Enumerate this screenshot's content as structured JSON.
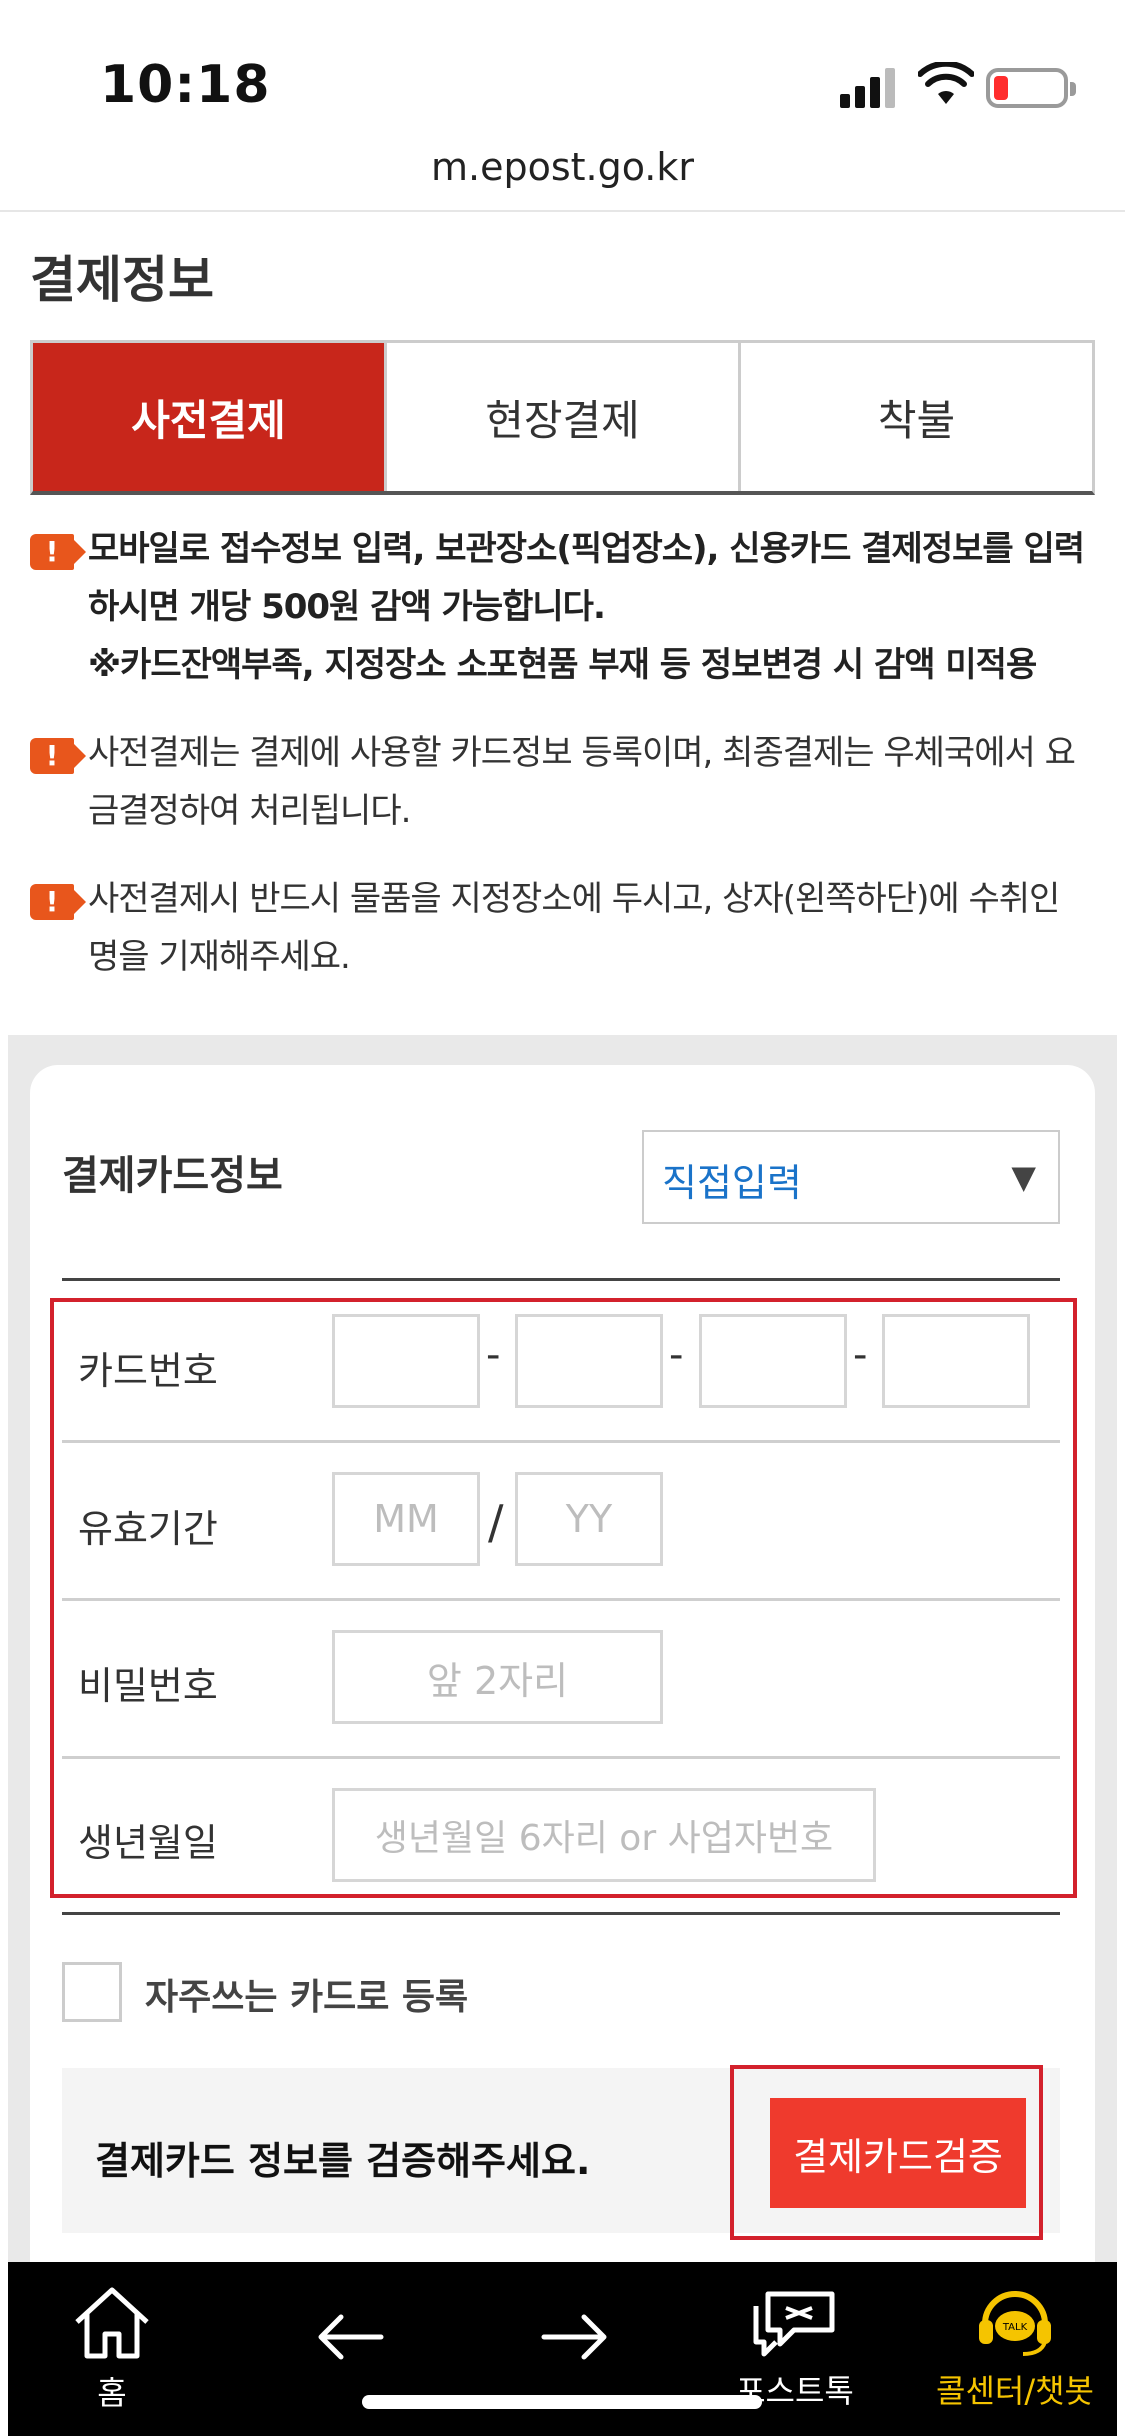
{
  "status_bar": {
    "time": "10:18",
    "url": "m.epost.go.kr"
  },
  "page": {
    "section_title": "결제정보"
  },
  "tabs": [
    {
      "label": "사전결제",
      "active": true
    },
    {
      "label": "현장결제",
      "active": false
    },
    {
      "label": "착불",
      "active": false
    }
  ],
  "notices": [
    {
      "bold": true,
      "lines": [
        "모바일로 접수정보 입력, 보관장소(픽업장소), 신용카드 결제정보를 입력",
        "하시면 개당 500원 감액 가능합니다.",
        "※카드잔액부족, 지정장소 소포현품 부재 등 정보변경 시 감액 미적용"
      ]
    },
    {
      "bold": false,
      "lines": [
        "사전결제는 결제에 사용할 카드정보 등록이며, 최종결제는 우체국에서 요",
        "금결정하여 처리됩니다."
      ]
    },
    {
      "bold": false,
      "lines": [
        "사전결제시 반드시 물품을 지정장소에 두시고, 상자(왼쪽하단)에 수취인",
        "명을 기재해주세요."
      ]
    }
  ],
  "card_form": {
    "title": "결제카드정보",
    "input_method": "직접입력",
    "card_number_label": "카드번호",
    "card_number_separator": "-",
    "expiry_label": "유효기간",
    "expiry_month_placeholder": "MM",
    "expiry_separator": "/",
    "expiry_year_placeholder": "YY",
    "password_label": "비밀번호",
    "password_placeholder": "앞 2자리",
    "birth_label": "생년월일",
    "birth_placeholder": "생년월일 6자리 or 사업자번호",
    "save_card_label": "자주쓰는 카드로 등록",
    "verify_message": "결제카드 정보를 검증해주세요.",
    "verify_button": "결제카드검증"
  },
  "bottom_nav": {
    "home": "홈",
    "back": "",
    "forward": "",
    "posttalk": "포스트톡",
    "callcenter": "콜센터/챗봇"
  },
  "colors": {
    "accent_red": "#c8261b",
    "button_red": "#ef3a2d",
    "link_blue": "#1a73c9",
    "gold": "#f5c400",
    "notice_orange": "#e8561c"
  }
}
